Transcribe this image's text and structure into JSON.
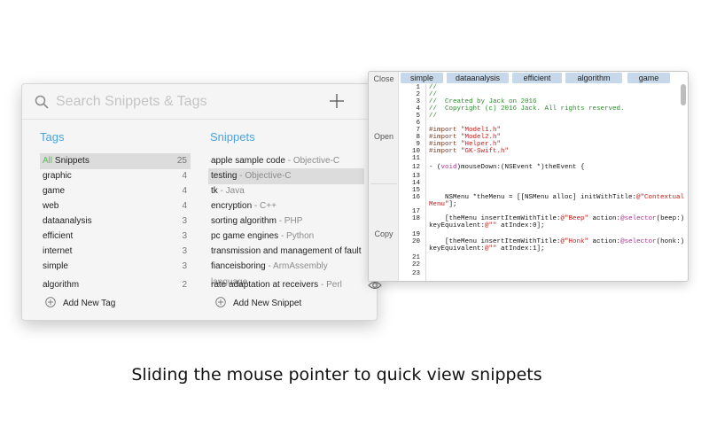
{
  "search": {
    "placeholder": "Search Snippets & Tags"
  },
  "tags": {
    "title": "Tags",
    "items": [
      {
        "label_prefix": "All",
        "label": " Snippets",
        "count": "25",
        "selected": true
      },
      {
        "label": "graphic",
        "count": "4"
      },
      {
        "label": "game",
        "count": "4"
      },
      {
        "label": "web",
        "count": "4"
      },
      {
        "label": "dataanalysis",
        "count": "3"
      },
      {
        "label": "efficient",
        "count": "3"
      },
      {
        "label": "internet",
        "count": "3"
      },
      {
        "label": "simple",
        "count": "3"
      },
      {
        "label": "algorithm",
        "count": "2"
      }
    ],
    "add_label": "Add New Tag"
  },
  "snippets": {
    "title": "Snippets",
    "items": [
      {
        "name": "apple sample code",
        "lang": " - Objective-C"
      },
      {
        "name": "testing",
        "lang": "  - Objective-C",
        "selected": true
      },
      {
        "name": "tk",
        "lang": " - Java"
      },
      {
        "name": "encryption",
        "lang": " - C++"
      },
      {
        "name": "sorting algorithm",
        "lang": " - PHP"
      },
      {
        "name": "pc game engines",
        "lang": " - Python"
      },
      {
        "name": "transmission and management of fault",
        "lang": ""
      },
      {
        "name": "fianceisboring",
        "lang": " - ArmAssembly language"
      },
      {
        "name": "rate adaptation at receivers",
        "lang": " - Perl"
      }
    ],
    "add_label": "Add New Snippet"
  },
  "quickview": {
    "close_label": "Close",
    "open_label": "Open",
    "copy_label": "Copy",
    "tabs": [
      "simple",
      "dataanalysis",
      "efficient",
      "algorithm",
      "game"
    ],
    "line_numbers": [
      "1",
      "2",
      "3",
      "4",
      "5",
      "6",
      "7",
      "8",
      "9",
      "10",
      "11",
      "12",
      "13",
      "14",
      "15",
      "16",
      "17",
      "18",
      "19",
      "20",
      "21",
      "22",
      "23"
    ],
    "code": {
      "l1": "//",
      "l2": "//",
      "l3": "//  Created by Jack on 2016",
      "l4": "//  Copyright (c) 2016 Jack. All rights reserved.",
      "l5": "//",
      "import_kw": "#import",
      "imp1": "\"Model1.h\"",
      "imp2": "\"Model2.h\"",
      "imp3": "\"Helper.h\"",
      "imp4": "\"GK-Swift.h\"",
      "l12a": "- (",
      "l12b": "void",
      "l12c": ")mouseDown:(NSEvent *)theEvent {",
      "l16a": "    NSMenu *theMenu = [[NSMenu alloc] initWithTitle:",
      "l16b": "@\"Contextual",
      "l16c": "Menu\"",
      "l16d": "];",
      "l18a": "    [theMenu insertItemWithTitle:",
      "l18b": "@\"Beep\"",
      "l18c": " action:",
      "l18d": "@selector",
      "l18e": "(beep:)",
      "l18f": "keyEquivalent:",
      "l18g": "@\"\"",
      "l18h": " atIndex:0];",
      "l20b": "@\"Honk\"",
      "l20e": "(honk:)",
      "l20h": " atIndex:1];"
    }
  },
  "caption": "Sliding the mouse pointer to quick view snippets",
  "colors": {
    "accent": "#4aa3df",
    "tab": "#c6d8ea",
    "selection": "#dcdcdc"
  }
}
